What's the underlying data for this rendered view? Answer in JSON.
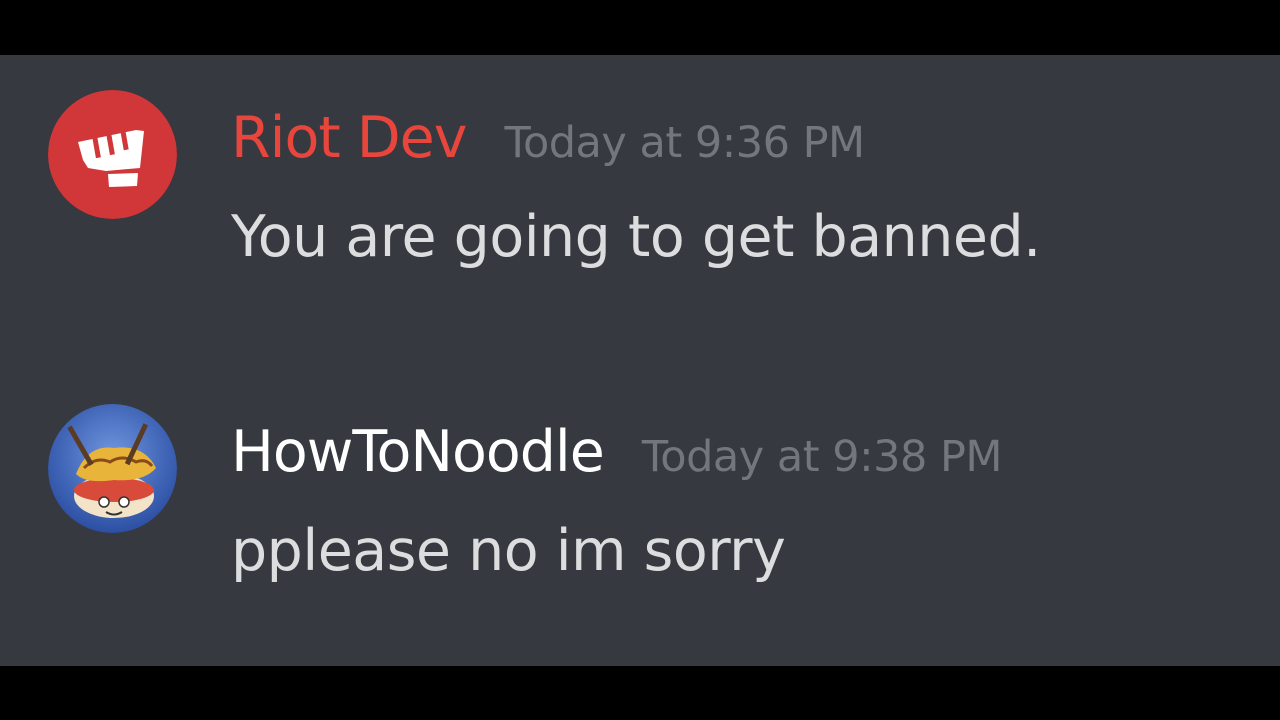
{
  "theme": {
    "background": "#36393f",
    "letterbox": "#000000",
    "timestamp_color": "#72767d",
    "text_color": "#dcddde"
  },
  "messages": [
    {
      "author": "Riot Dev",
      "author_color": "#e8453c",
      "timestamp": "Today at 9:36 PM",
      "text": "You are going to get banned.",
      "avatar": {
        "icon": "riot-fist-logo-icon",
        "background": "#d13639"
      }
    },
    {
      "author": "HowToNoodle",
      "author_color": "#ffffff",
      "timestamp": "Today at 9:38 PM",
      "text": "pplease no im sorry",
      "avatar": {
        "icon": "howtonoodle-avatar-icon",
        "background": "#3b5fb5"
      }
    }
  ]
}
